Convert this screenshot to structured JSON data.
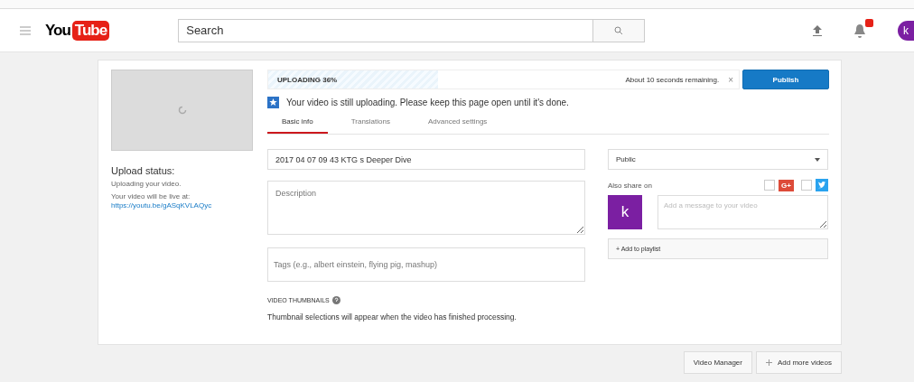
{
  "header": {
    "logo_left": "You",
    "logo_right": "Tube",
    "search": {
      "placeholder": "Search"
    },
    "notification_badge": true,
    "avatar_letter": "k"
  },
  "upload": {
    "status_title": "Upload status:",
    "status_text": "Uploading your video.",
    "live_label": "Your video will be live at:",
    "live_link": "https://youtu.be/gASqKVLAQyc"
  },
  "progress": {
    "label": "UPLOADING 36%",
    "level": 0.36,
    "remaining": "About 10 seconds remaining.",
    "close": "×"
  },
  "publish_button": "Publish",
  "notice": "Your video is still uploading. Please keep this page open until it's done.",
  "tabs": [
    {
      "label": "Basic info",
      "selected": true
    },
    {
      "label": "Translations",
      "selected": false
    },
    {
      "label": "Advanced settings",
      "selected": false
    }
  ],
  "title_field": {
    "value": "2017 04 07 09 43 KTG s Deeper Dive"
  },
  "description_field": {
    "placeholder": "Description"
  },
  "tags_field": {
    "placeholder": "Tags (e.g., albert einstein, flying pig, mashup)"
  },
  "privacy": {
    "value": "Public"
  },
  "share": {
    "label": "Also share on",
    "google": {
      "label": "G+",
      "checked": false
    },
    "twitter": {
      "checked": false
    },
    "avatar_letter": "k",
    "message": {
      "placeholder": "Add a message to your video"
    }
  },
  "playlist_button": "+ Add to playlist",
  "thumbnails": {
    "title": "VIDEO THUMBNAILS",
    "text": "Thumbnail selections will appear when the video has finished processing."
  },
  "footer_buttons": [
    {
      "label": "Video Manager",
      "plus": false
    },
    {
      "label": "Add more videos",
      "plus": true
    }
  ]
}
